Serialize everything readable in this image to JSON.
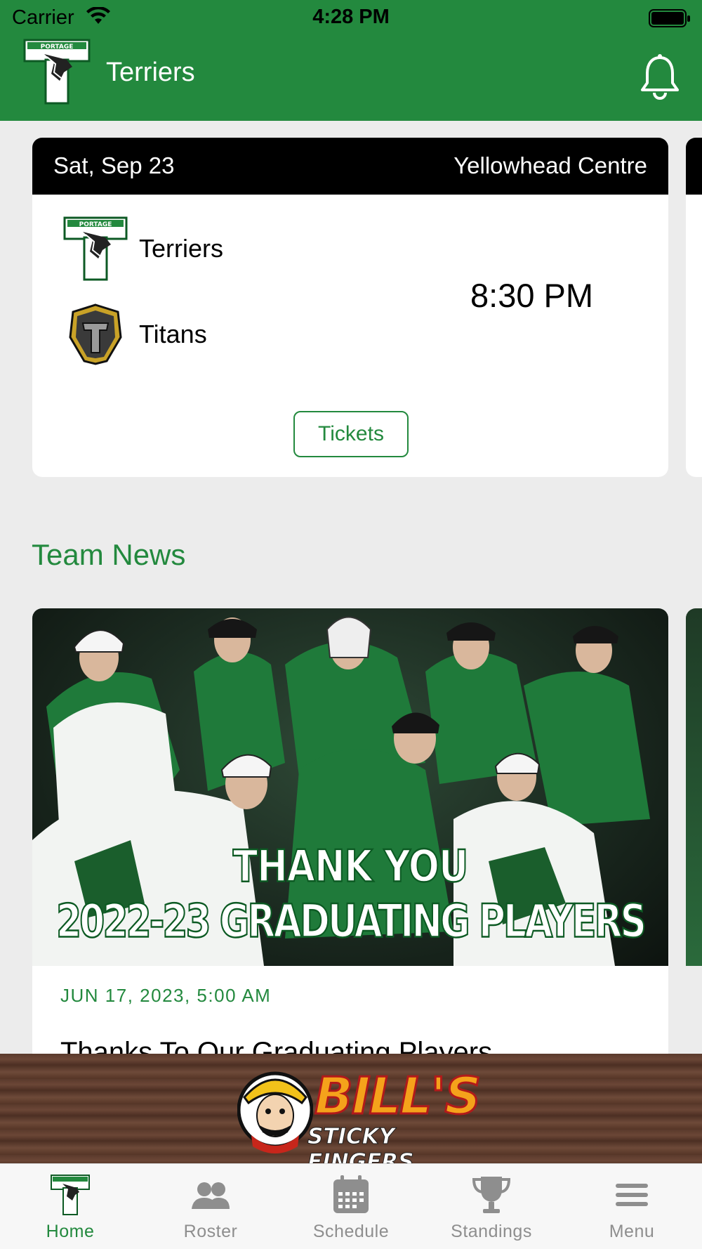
{
  "status_bar": {
    "carrier": "Carrier",
    "time": "4:28 PM"
  },
  "header": {
    "title": "Terriers",
    "logo": "portage-terriers-logo",
    "icon": "bell-icon"
  },
  "game": {
    "date": "Sat, Sep 23",
    "venue": "Yellowhead Centre",
    "home_team": "Terriers",
    "away_team": "Titans",
    "time": "8:30 PM",
    "tickets_label": "Tickets"
  },
  "news_section": {
    "title": "Team News",
    "items": [
      {
        "image_line1": "THANK YOU",
        "image_line2": "2022-23 GRADUATING PLAYERS",
        "date": "JUN 17, 2023, 5:00 AM",
        "title": "Thanks To Our Graduating Players"
      }
    ]
  },
  "sponsor": {
    "name": "BILL'S",
    "tagline": "STICKY FINGERS"
  },
  "tabs": [
    {
      "label": "Home",
      "icon": "team-logo-icon",
      "active": true
    },
    {
      "label": "Roster",
      "icon": "people-icon",
      "active": false
    },
    {
      "label": "Schedule",
      "icon": "calendar-icon",
      "active": false
    },
    {
      "label": "Standings",
      "icon": "trophy-icon",
      "active": false
    },
    {
      "label": "Menu",
      "icon": "hamburger-icon",
      "active": false
    }
  ],
  "colors": {
    "brand_green": "#23893e",
    "background": "#ececec",
    "tab_inactive": "#8e8e8e"
  }
}
